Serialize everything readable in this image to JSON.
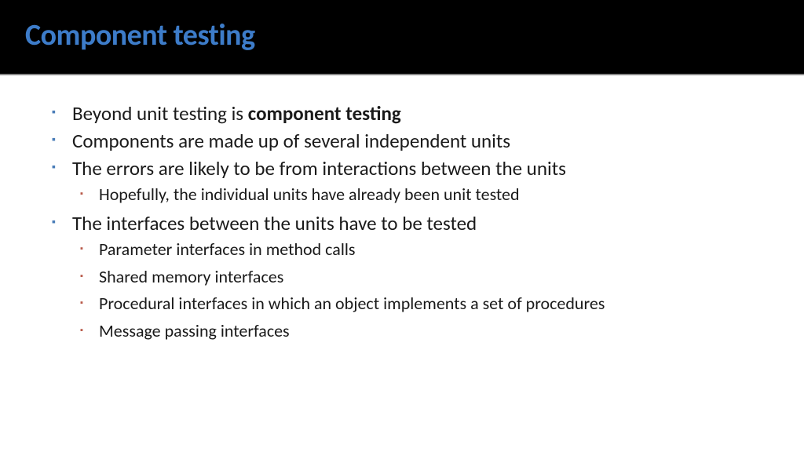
{
  "title": "Component testing",
  "bullets": [
    {
      "prefix": "Beyond unit testing is ",
      "bold": "component testing",
      "suffix": ""
    },
    {
      "text": "Components are made up of several independent units"
    },
    {
      "text": "The errors are likely to be from interactions between the units",
      "sub": [
        "Hopefully, the individual units have already been unit tested"
      ]
    },
    {
      "text": "The interfaces between the units have to be tested",
      "sub": [
        "Parameter interfaces in method calls",
        "Shared memory interfaces",
        "Procedural interfaces in which an object implements a set of procedures",
        "Message passing interfaces"
      ]
    }
  ]
}
